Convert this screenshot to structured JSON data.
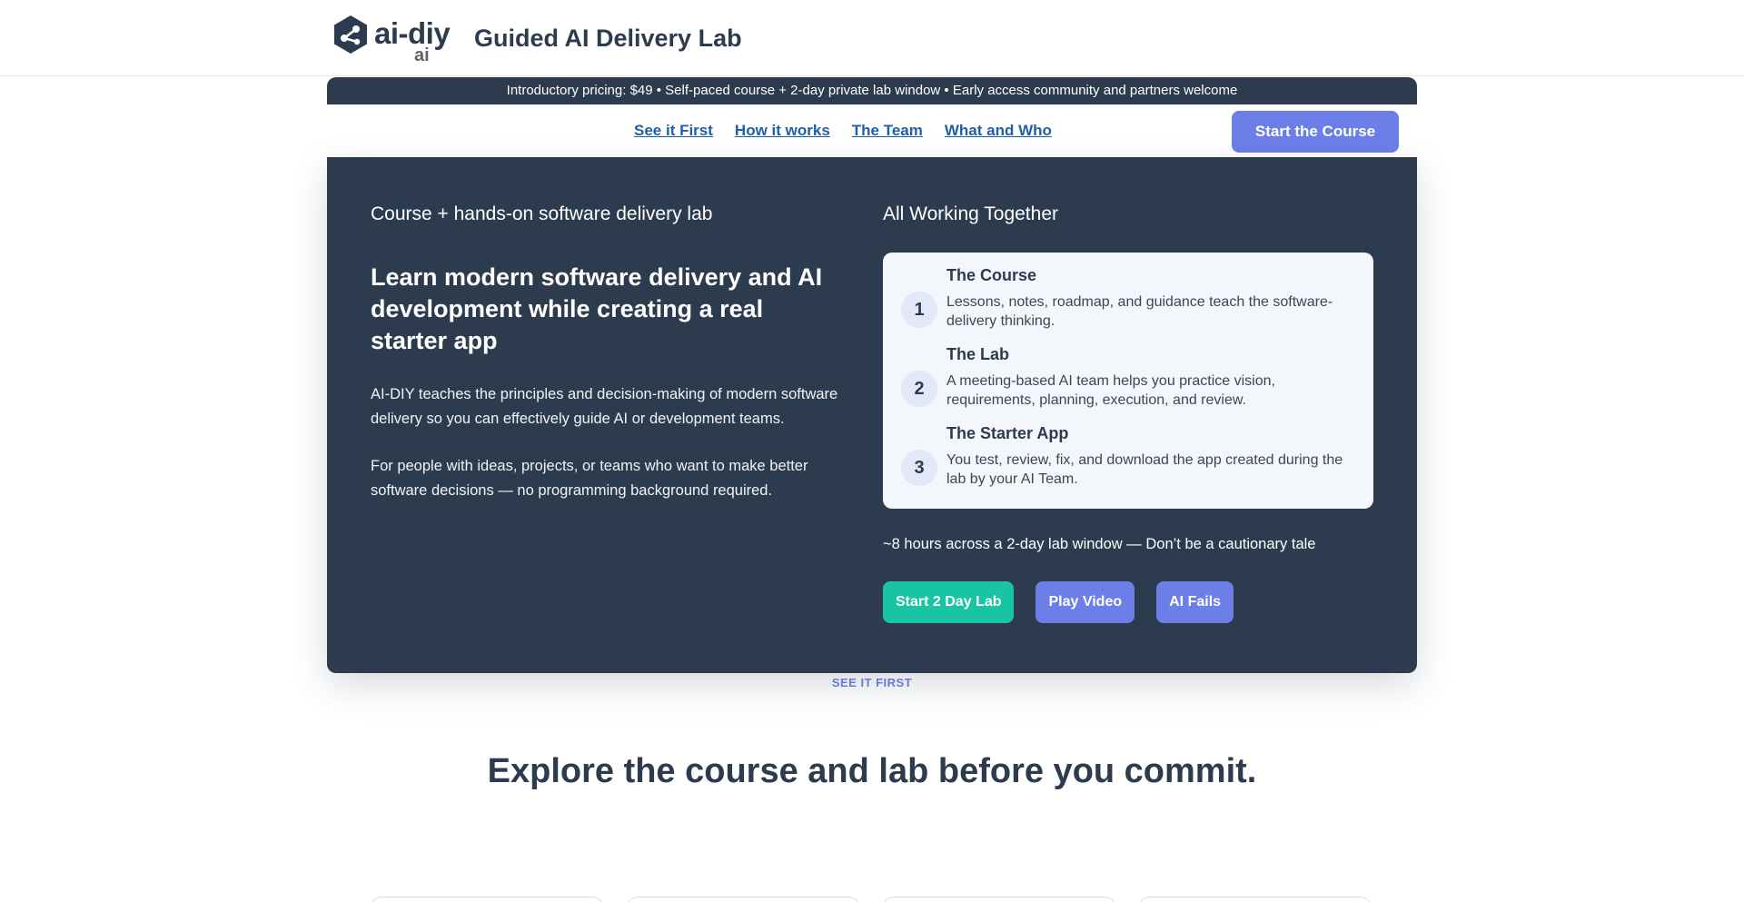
{
  "header": {
    "logo_word": "ai-diy",
    "logo_sub": "ai",
    "title": "Guided AI Delivery Lab"
  },
  "banner": {
    "text": "Introductory pricing: $49 • Self-paced course + 2-day private lab window • Early access community and partners welcome"
  },
  "nav": {
    "links": [
      "See it First",
      "How it works",
      "The Team",
      "What and Who"
    ],
    "cta": "Start the Course"
  },
  "hero": {
    "eyebrow": "Course + hands-on software delivery lab",
    "heading": "Learn modern software delivery and AI development while creating a real starter app",
    "paragraph1": "AI-DIY teaches the principles and decision-making of modern software delivery so you can effectively guide AI or development teams.",
    "paragraph2": "For people with ideas, projects, or teams who want to make better software decisions — no programming background required.",
    "right_title": "All Working Together",
    "steps": [
      {
        "num": "1",
        "title": "The Course",
        "desc": "Lessons, notes, roadmap, and guidance teach the software-delivery thinking."
      },
      {
        "num": "2",
        "title": "The Lab",
        "desc": "A meeting-based AI team helps you practice vision, requirements, planning, execution, and review."
      },
      {
        "num": "3",
        "title": "The Starter App",
        "desc": "You test, review, fix, and download the app created during the lab by your AI Team."
      }
    ],
    "duration": "~8 hours across a 2-day lab window — Don’t be a cautionary tale",
    "buttons": [
      "Start 2 Day Lab",
      "Play Video",
      "AI Fails"
    ]
  },
  "section": {
    "eyebrow": "SEE IT FIRST",
    "title": "Explore the course and lab before you commit."
  },
  "colors": {
    "navy": "#2d3b4e",
    "indigo": "#6c7fe8",
    "green": "#18c4a2",
    "link": "#1f5fa8"
  }
}
